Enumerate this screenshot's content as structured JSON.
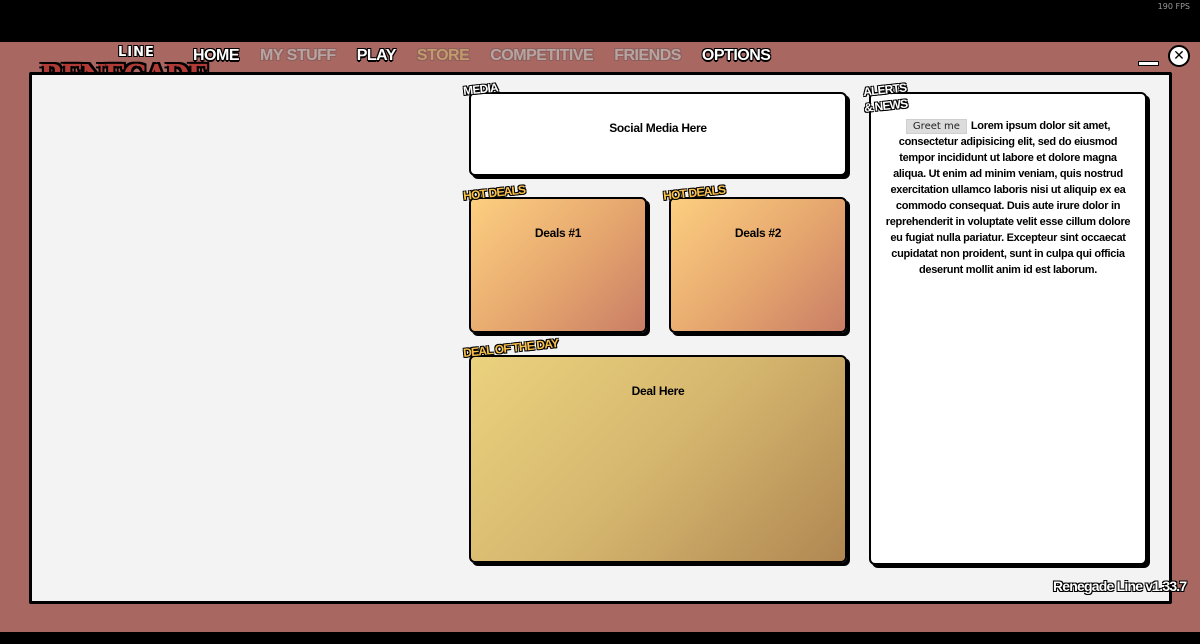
{
  "fps_counter": "190 FPS",
  "logo": {
    "line": "LINE",
    "main": "RENEGADE"
  },
  "nav": [
    {
      "label": "HOME",
      "state": "active"
    },
    {
      "label": "MY STUFF",
      "state": "dim"
    },
    {
      "label": "PLAY",
      "state": "active"
    },
    {
      "label": "STORE",
      "state": "store"
    },
    {
      "label": "COMPETITIVE",
      "state": "dim"
    },
    {
      "label": "FRIENDS",
      "state": "dim"
    },
    {
      "label": "OPTIONS",
      "state": "active"
    }
  ],
  "window": {
    "close_glyph": "✕"
  },
  "media": {
    "tag": "MEDIA",
    "text": "Social Media Here"
  },
  "hot_deals": [
    {
      "tag": "HOT DEALS",
      "text": "Deals #1"
    },
    {
      "tag": "HOT DEALS",
      "text": "Deals #2"
    }
  ],
  "deal_of_the_day": {
    "tag": "DEAL OF THE DAY",
    "text": "Deal Here"
  },
  "alerts": {
    "tag_line1": "ALERTS",
    "tag_line2": "& NEWS",
    "button_label": "Greet me",
    "body": "Lorem ipsum dolor sit amet, consectetur adipisicing elit, sed do eiusmod tempor incididunt ut labore et dolore magna aliqua. Ut enim ad minim veniam, quis nostrud exercitation ullamco laboris nisi ut aliquip ex ea commodo consequat. Duis aute irure dolor in reprehenderit in voluptate velit esse cillum dolore eu fugiat nulla pariatur. Excepteur sint occaecat cupidatat non proident, sunt in culpa qui officia deserunt mollit anim id est laborum."
  },
  "version": "Renegade Line v1.33.7",
  "colors": {
    "frame": "#a96762",
    "panel": "#f3f3f3",
    "tag_gold": "#f7c04a"
  }
}
